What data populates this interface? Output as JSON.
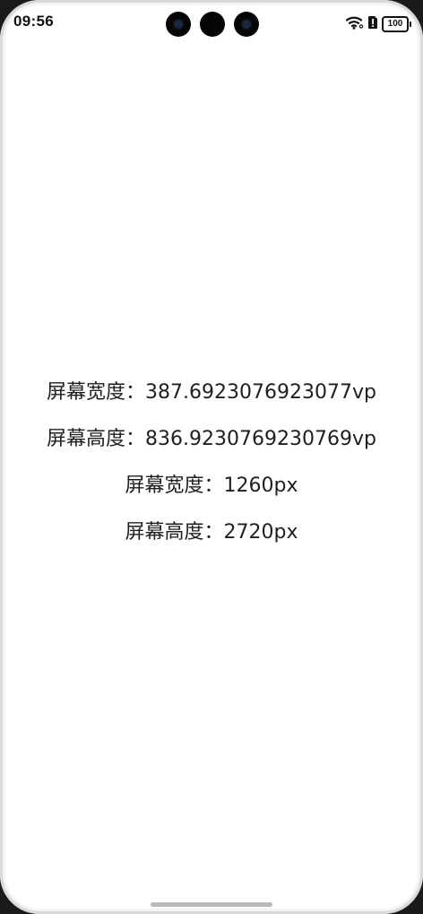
{
  "status_bar": {
    "time": "09:56",
    "battery_level": "100",
    "icons": [
      "wifi-icon",
      "sim-alert-icon",
      "battery-icon"
    ]
  },
  "screen_info": [
    {
      "label": "屏幕宽度：",
      "value": "387.6923076923077vp"
    },
    {
      "label": "屏幕高度：",
      "value": "836.9230769230769vp"
    },
    {
      "label": "屏幕宽度：",
      "value": "1260px"
    },
    {
      "label": "屏幕高度：",
      "value": "2720px"
    }
  ],
  "colors": {
    "background": "#ffffff",
    "text": "#1f1f1f",
    "home_indicator": "#b9b9b9"
  }
}
